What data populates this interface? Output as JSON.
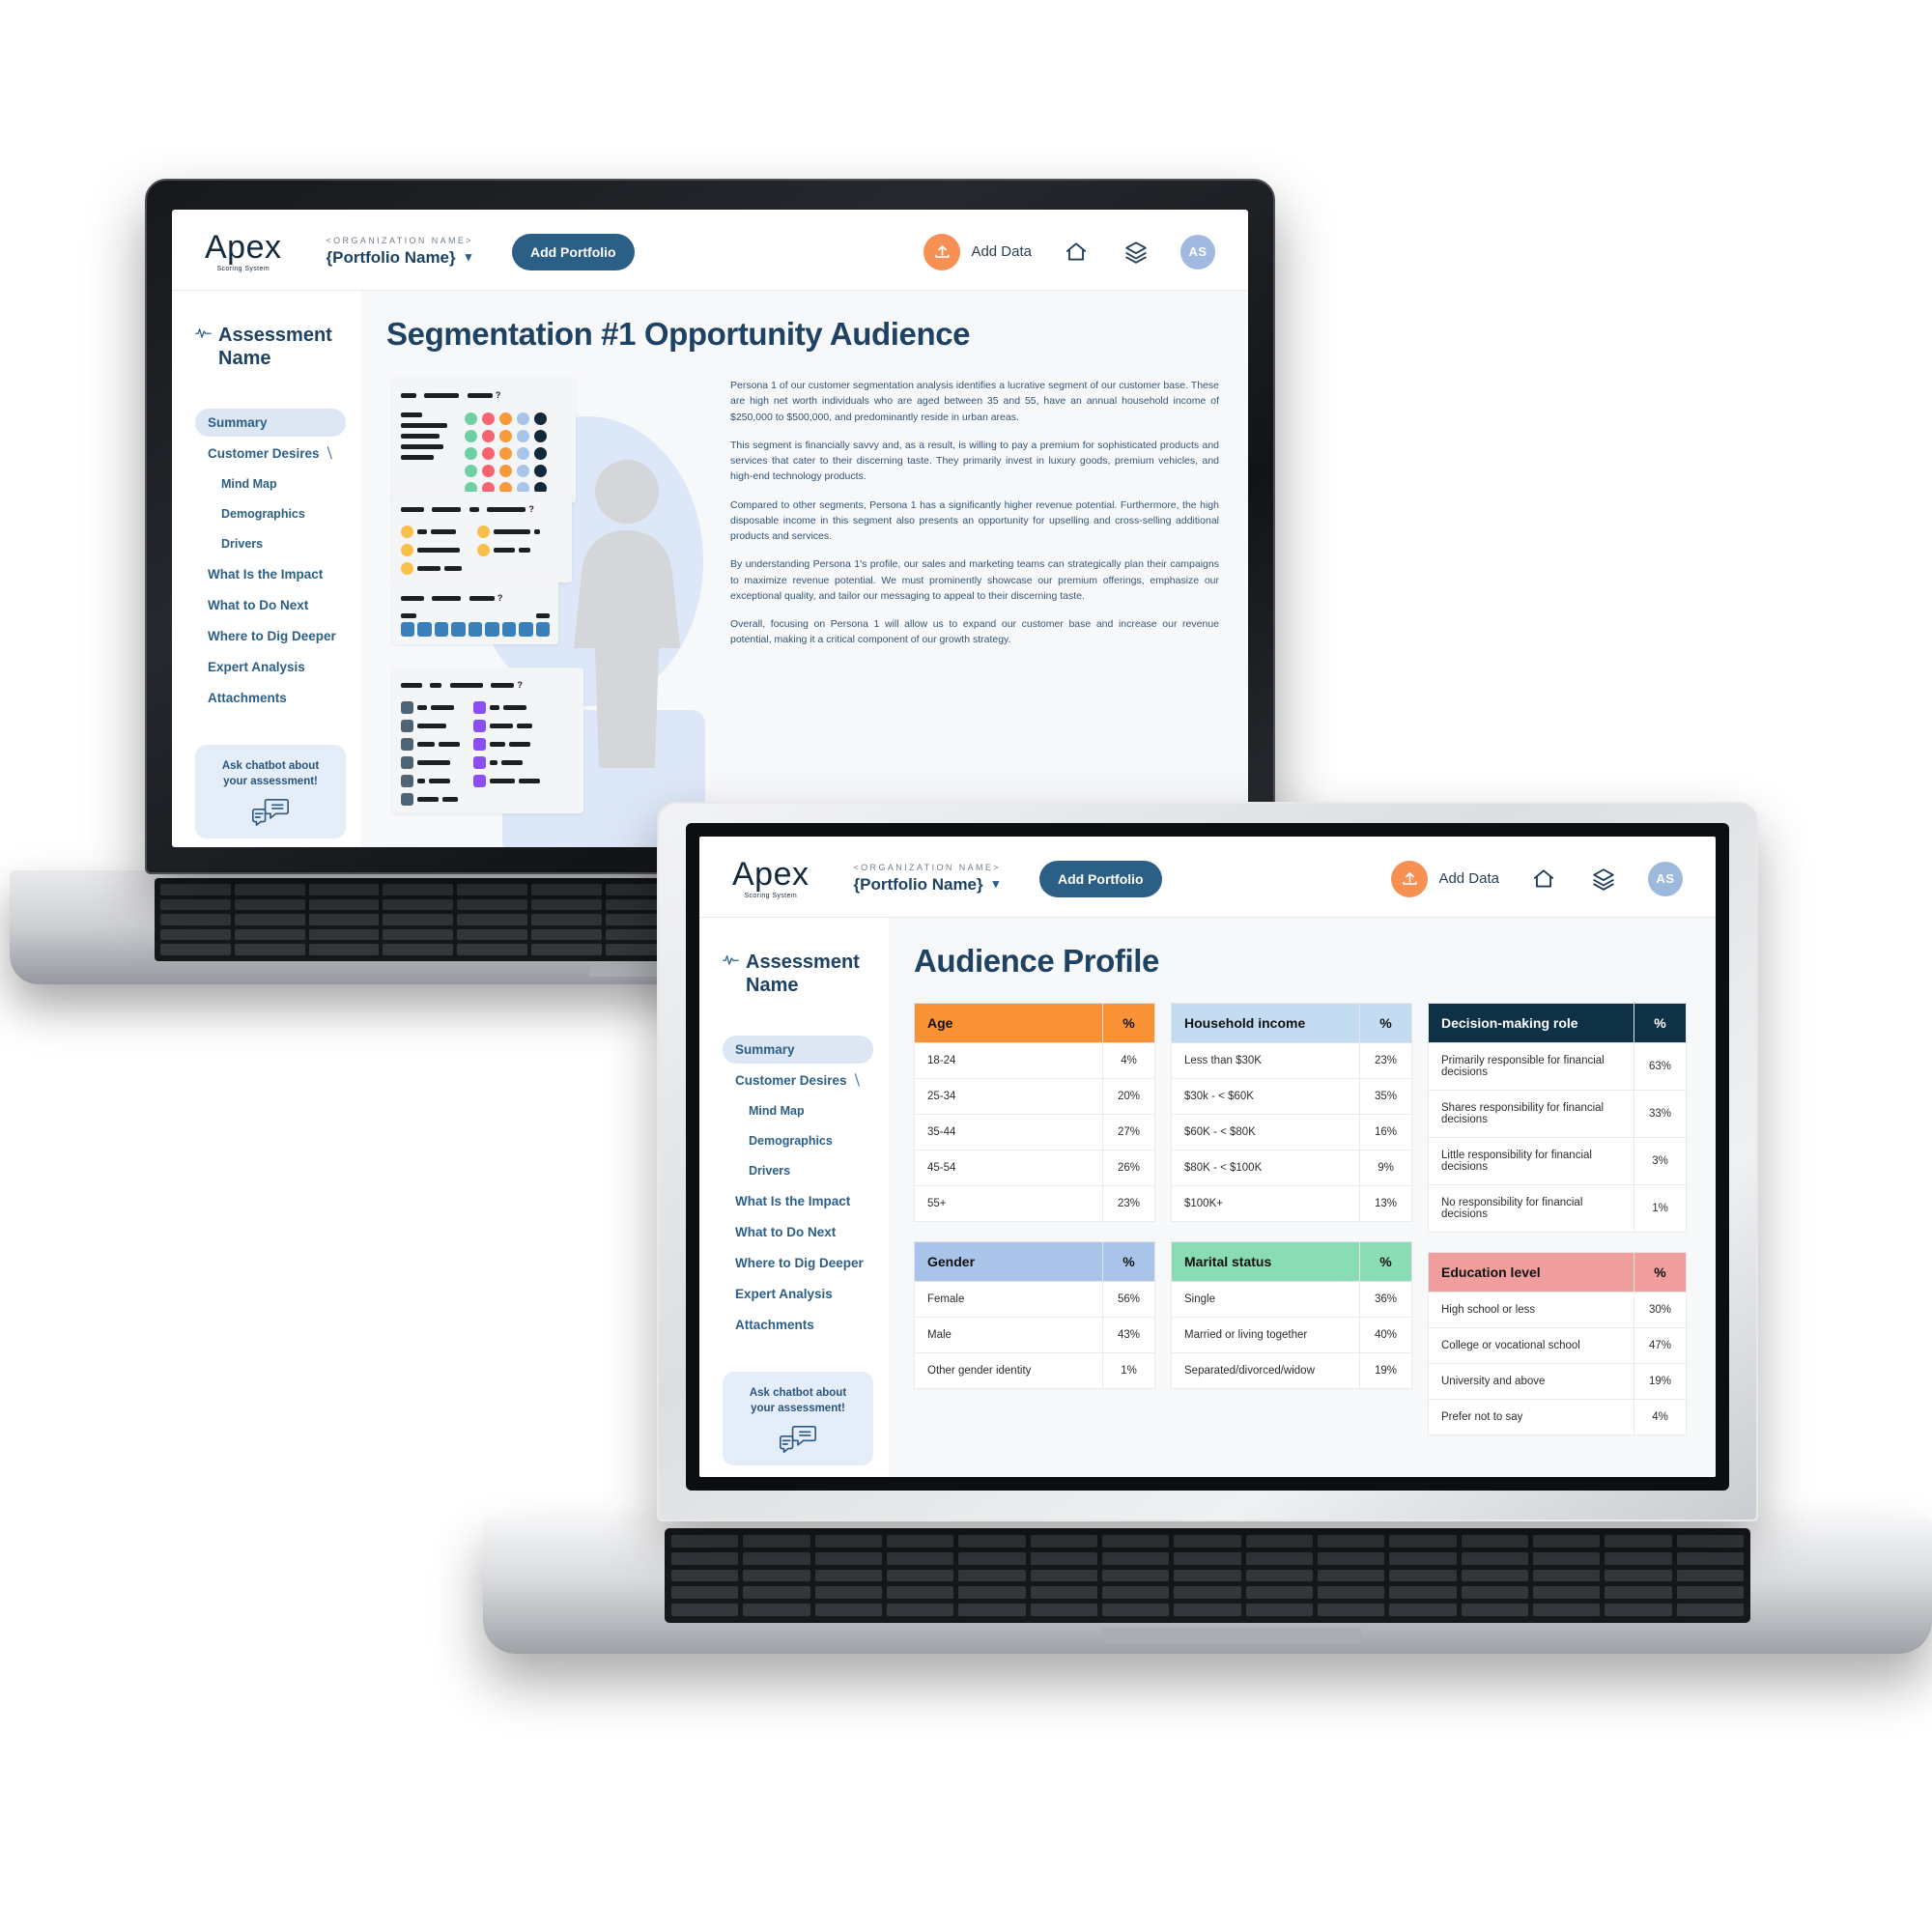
{
  "header": {
    "logo_word": "Apex",
    "logo_tagline": "Scoring System",
    "org_label": "<ORGANIZATION NAME>",
    "portfolio_name": "{Portfolio Name}",
    "chevron": "chevron-down-icon",
    "add_portfolio_label": "Add Portfolio",
    "add_data_label": "Add Data",
    "avatar_initials": "AS"
  },
  "sidebar": {
    "assessment_title": "Assessment Name",
    "items": [
      {
        "label": "Summary",
        "active": true,
        "sub": false,
        "caret": false
      },
      {
        "label": "Customer Desires",
        "active": false,
        "sub": false,
        "caret": true
      },
      {
        "label": "Mind Map",
        "active": false,
        "sub": true,
        "caret": false
      },
      {
        "label": "Demographics",
        "active": false,
        "sub": true,
        "caret": false
      },
      {
        "label": "Drivers",
        "active": false,
        "sub": true,
        "caret": false
      },
      {
        "label": "What Is the Impact",
        "active": false,
        "sub": false,
        "caret": false
      },
      {
        "label": "What to Do Next",
        "active": false,
        "sub": false,
        "caret": false
      },
      {
        "label": "Where to Dig Deeper",
        "active": false,
        "sub": false,
        "caret": false
      },
      {
        "label": "Expert Analysis",
        "active": false,
        "sub": false,
        "caret": false
      },
      {
        "label": "Attachments",
        "active": false,
        "sub": false,
        "caret": false
      }
    ],
    "chatbot_line1": "Ask chatbot about",
    "chatbot_line2": "your assessment!"
  },
  "screen_back": {
    "page_title": "Segmentation #1 Opportunity Audience",
    "paragraphs": [
      "Persona 1 of our customer segmentation analysis identifies a lucrative segment of our customer base. These are high net worth individuals who are aged between 35 and 55, have an annual household income of $250,000 to $500,000, and predominantly reside in urban areas.",
      "This segment is financially savvy and, as a result, is willing to pay a premium for sophisticated products and services that cater to their discerning taste. They primarily invest in luxury goods, premium vehicles, and high-end technology products.",
      "Compared to other segments, Persona 1 has a significantly higher revenue potential. Furthermore, the high disposable income in this segment also presents an opportunity for upselling and cross-selling additional products and services.",
      "By understanding Persona 1's profile, our sales and marketing teams can strategically plan their campaigns to maximize revenue potential. We must prominently showcase our premium offerings, emphasize our exceptional quality, and tailor our messaging to appeal to their discerning taste.",
      "Overall, focusing on Persona 1 will allow us to expand our customer base and increase our revenue potential, making it a critical component of our growth strategy."
    ]
  },
  "screen_front": {
    "page_title": "Audience Profile",
    "pct_header": "%",
    "tables": [
      {
        "title": "Age",
        "accent": "#f89234",
        "rows": [
          {
            "label": "18-24",
            "value": "4%"
          },
          {
            "label": "25-34",
            "value": "20%"
          },
          {
            "label": "35-44",
            "value": "27%"
          },
          {
            "label": "45-54",
            "value": "26%"
          },
          {
            "label": "55+",
            "value": "23%"
          }
        ]
      },
      {
        "title": "Gender",
        "accent": "#a9c4e8",
        "rows": [
          {
            "label": "Female",
            "value": "56%"
          },
          {
            "label": "Male",
            "value": "43%"
          },
          {
            "label": "Other gender identity",
            "value": "1%"
          }
        ]
      },
      {
        "title": "Household income",
        "accent": "#c4dcf2",
        "rows": [
          {
            "label": "Less than $30K",
            "value": "23%"
          },
          {
            "label": "$30k - < $60K",
            "value": "35%"
          },
          {
            "label": "$60K - < $80K",
            "value": "16%"
          },
          {
            "label": "$80K - < $100K",
            "value": "9%"
          },
          {
            "label": "$100K+",
            "value": "13%"
          }
        ]
      },
      {
        "title": "Marital status",
        "accent": "#8adcb4",
        "rows": [
          {
            "label": "Single",
            "value": "36%"
          },
          {
            "label": "Married or living together",
            "value": "40%"
          },
          {
            "label": "Separated/divorced/widow",
            "value": "19%"
          }
        ]
      },
      {
        "title": "Decision-making role",
        "accent": "#0f3146",
        "rows": [
          {
            "label": "Primarily responsible for financial decisions",
            "value": "63%"
          },
          {
            "label": "Shares responsibility for financial decisions",
            "value": "33%"
          },
          {
            "label": "Little responsibility for financial decisions",
            "value": "3%"
          },
          {
            "label": "No responsibility for financial decisions",
            "value": "1%"
          }
        ]
      },
      {
        "title": "Education level",
        "accent": "#ef9d9d",
        "rows": [
          {
            "label": "High school or less",
            "value": "30%"
          },
          {
            "label": "College or vocational school",
            "value": "47%"
          },
          {
            "label": "University and above",
            "value": "19%"
          },
          {
            "label": "Prefer not to say",
            "value": "4%"
          }
        ]
      }
    ]
  },
  "illustration": {
    "dot_colors": [
      "#6fd0a4",
      "#f7636e",
      "#f8993a",
      "#a8c4e8",
      "#12293a"
    ],
    "accent_yellow": "#f9c049",
    "accent_blue": "#3b7fb8",
    "accent_slate": "#4f6575",
    "accent_purple": "#8b4ef0"
  }
}
